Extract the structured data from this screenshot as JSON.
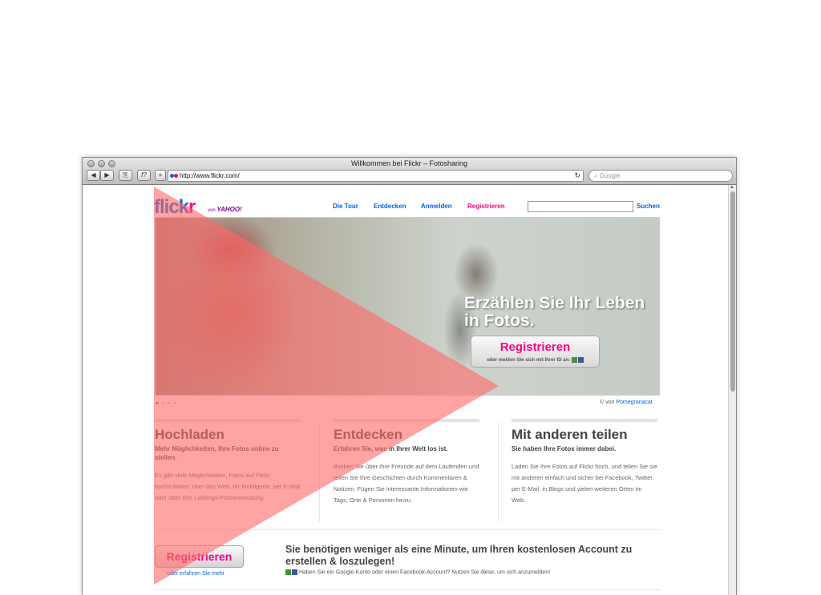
{
  "browser": {
    "window_title": "Willkommen bei Flickr – Fotosharing",
    "url": "http://www.flickr.com/",
    "search_placeholder": "Google",
    "back_glyph": "◀",
    "forward_glyph": "▶",
    "reload_glyph": "↻",
    "search_glyph": "⌕",
    "add_glyph": "+",
    "bookmark_glyph": "f?"
  },
  "site": {
    "logo_blue": "flick",
    "logo_pink": "r",
    "logo_by": "von",
    "logo_yahoo": "YAHOO!",
    "nav": {
      "tour": "Die Tour",
      "explore": "Entdecken",
      "signin": "Anmelden",
      "signup": "Registrieren"
    },
    "search_button": "Suchen"
  },
  "hero": {
    "headline": "Erzählen Sie Ihr Leben in Fotos.",
    "button_label": "Registrieren",
    "button_sub": "oder melden Sie sich mit Ihrer ID an:",
    "dots": "● ● ● ●",
    "credit_prefix": "© von",
    "credit_author": "Pomegranacat"
  },
  "columns": [
    {
      "title": "Hochladen",
      "subtitle": "Mehr Möglichkeiten, Ihre Fotos online zu stellen.",
      "body": "Es gibt viele Möglichkeiten, Fotos auf Flickr hochzuladen: über das Web, Ihr Mobilgerät, per E-Mail oder über Ihre Lieblings-Fotoanwendung."
    },
    {
      "title": "Entdecken",
      "subtitle": "Erfahren Sie, was in Ihrer Welt los ist.",
      "body": "Bleiben Sie über Ihre Freunde auf dem Laufenden und teilen Sie Ihre Geschichten durch Kommentaren & Notizen. Fügen Sie interessante Informationen wie Tags, Orte & Personen hinzu."
    },
    {
      "title": "Mit anderen teilen",
      "subtitle": "Sie haben Ihre Fotos immer dabei.",
      "body": "Laden Sie Ihre Fotos auf Flickr hoch, und teilen Sie sie mit anderen einfach und sicher bei Facebook, Twitter, per E-Mail, in Blogs und vielen weiteren Orten im Web."
    }
  ],
  "signup": {
    "button": "Registrieren",
    "link": "oder erfahren Sie mehr",
    "heading": "Sie benötigen weniger als eine Minute, um Ihren kostenlosen Account zu erstellen & loszulegen!",
    "note": "Haben Sie ein Google-Konto oder einen Facebook-Account? Nutzen Sie diese, um sich anzumelden!"
  },
  "colors": {
    "flickr_blue": "#0063dc",
    "flickr_pink": "#ff0084",
    "overlay_pink": "#ff8a8a"
  }
}
